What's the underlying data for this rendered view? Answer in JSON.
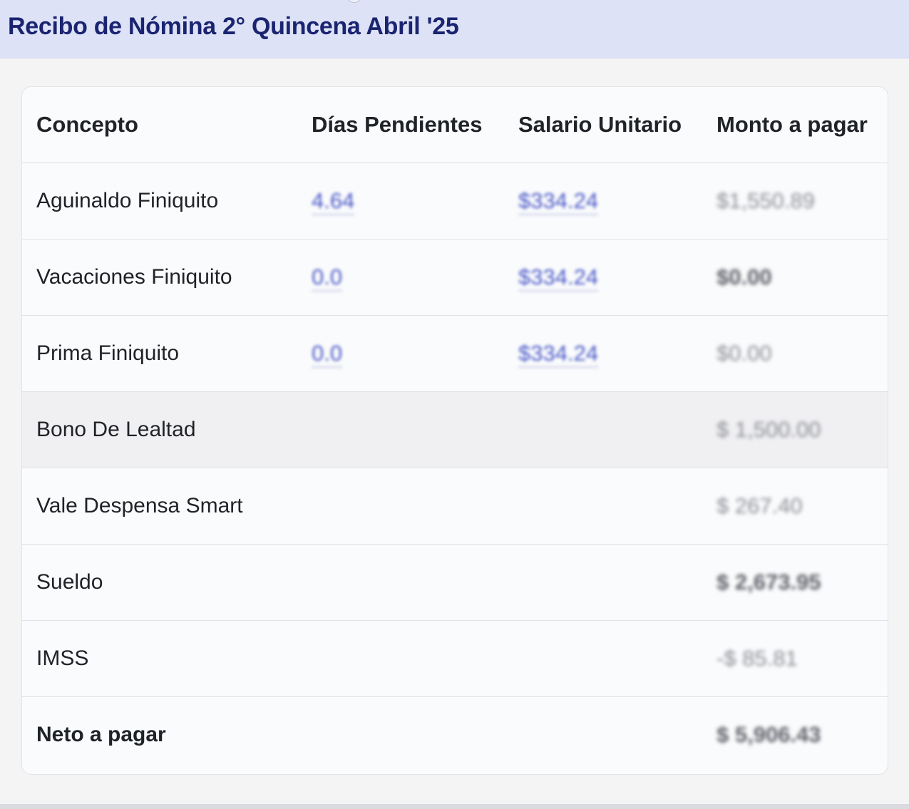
{
  "header": {
    "title": "Recibo de Nómina 2° Quincena Abril '25"
  },
  "table": {
    "columns": [
      "Concepto",
      "Días Pendientes",
      "Salario Unitario",
      "Monto a pagar"
    ],
    "rows": [
      {
        "concepto": "Aguinaldo Finiquito",
        "dias": "4.64",
        "salario": "$334.24",
        "monto": "$1,550.89"
      },
      {
        "concepto": "Vacaciones Finiquito",
        "dias": "0.0",
        "salario": "$334.24",
        "monto": "$0.00"
      },
      {
        "concepto": "Prima Finiquito",
        "dias": "0.0",
        "salario": "$334.24",
        "monto": "$0.00"
      },
      {
        "concepto": "Bono De Lealtad",
        "dias": "",
        "salario": "",
        "monto": "$ 1,500.00"
      },
      {
        "concepto": "Vale Despensa Smart",
        "dias": "",
        "salario": "",
        "monto": "$ 267.40"
      },
      {
        "concepto": "Sueldo",
        "dias": "",
        "salario": "",
        "monto": "$ 2,673.95"
      },
      {
        "concepto": "IMSS",
        "dias": "",
        "salario": "",
        "monto": "-$ 85.81"
      },
      {
        "concepto": "Neto a pagar",
        "dias": "",
        "salario": "",
        "monto": "$ 5,906.43"
      }
    ]
  }
}
